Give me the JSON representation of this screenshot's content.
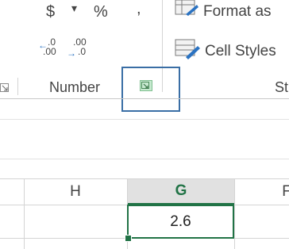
{
  "ribbon": {
    "currency_symbol": "$",
    "dropdown_arrow": "▾",
    "percent_symbol": "%",
    "comma_style": ",",
    "increase_decimal": {
      "top": ".0",
      "bottom": ".00"
    },
    "decrease_decimal": {
      "top": ".00",
      "bottom": ".0"
    },
    "format_as_table_label": "Format as",
    "cell_styles_label": "Cell Styles",
    "number_group_label": "Number",
    "styles_group_label_partial": "St"
  },
  "sheet": {
    "columns": [
      "H",
      "G",
      "F"
    ],
    "selected_column": "G",
    "active_cell_value": "2.6"
  },
  "colors": {
    "excel_green": "#217346",
    "highlight_blue": "#3a6ea5",
    "launcher_fill": "#c6e9cf"
  }
}
